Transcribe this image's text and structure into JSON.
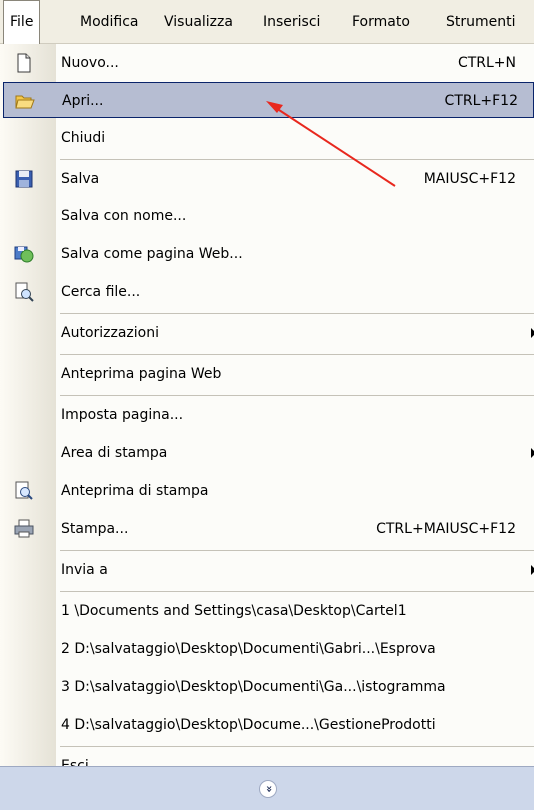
{
  "menubar": {
    "items": [
      "File",
      "Modifica",
      "Visualizza",
      "Inserisci",
      "Formato",
      "Strumenti"
    ]
  },
  "menu": {
    "nuovo": {
      "label": "Nuovo...",
      "shortcut": "CTRL+N"
    },
    "apri": {
      "label": "Apri...",
      "shortcut": "CTRL+F12"
    },
    "chiudi": {
      "label": "Chiudi"
    },
    "salva": {
      "label": "Salva",
      "shortcut": "MAIUSC+F12"
    },
    "salva_con_nome": {
      "label": "Salva con nome..."
    },
    "salva_web": {
      "label": "Salva come pagina Web..."
    },
    "cerca": {
      "label": "Cerca file..."
    },
    "autorizzazioni": {
      "label": "Autorizzazioni"
    },
    "anteprima_web": {
      "label": "Anteprima pagina Web"
    },
    "imposta": {
      "label": "Imposta pagina..."
    },
    "area": {
      "label": "Area di stampa"
    },
    "anteprima_stampa": {
      "label": "Anteprima di stampa"
    },
    "stampa": {
      "label": "Stampa...",
      "shortcut": "CTRL+MAIUSC+F12"
    },
    "invia": {
      "label": "Invia a"
    },
    "recent": [
      "1 \\Documents and Settings\\casa\\Desktop\\Cartel1",
      "2 D:\\salvataggio\\Desktop\\Documenti\\Gabri...\\Esprova",
      "3 D:\\salvataggio\\Desktop\\Documenti\\Ga...\\istogramma",
      "4 D:\\salvataggio\\Desktop\\Docume...\\GestioneProdotti"
    ],
    "esci": {
      "label": "Esci"
    },
    "expand_glyph": "»"
  },
  "colors": {
    "highlight": "#b6bdd2",
    "highlight_border": "#0a246a",
    "annotation_arrow": "#e8281e"
  }
}
